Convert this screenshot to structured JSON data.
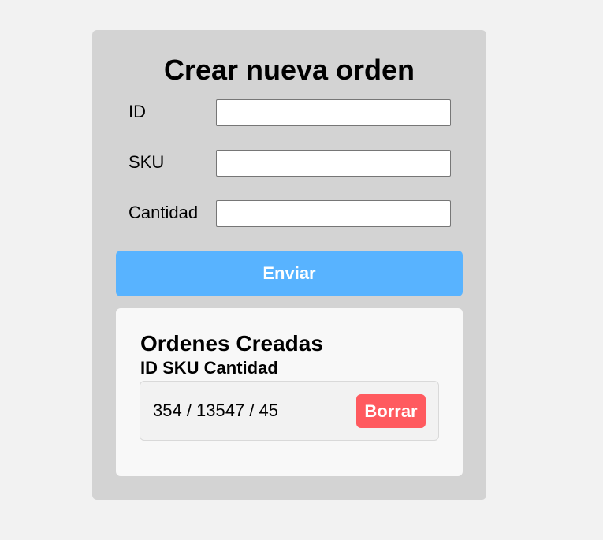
{
  "form": {
    "title": "Crear nueva orden",
    "fields": [
      {
        "label": "ID",
        "value": "",
        "placeholder": ""
      },
      {
        "label": "SKU",
        "value": "",
        "placeholder": ""
      },
      {
        "label": "Cantidad",
        "value": "",
        "placeholder": ""
      }
    ],
    "submit_label": "Enviar",
    "submit_color": "#58b3ff"
  },
  "orders": {
    "title": "Ordenes Creadas",
    "header": "ID SKU Cantidad",
    "items": [
      {
        "text": "354 / 13547 / 45",
        "delete_label": "Borrar"
      }
    ],
    "delete_color": "#ff5a5f"
  }
}
